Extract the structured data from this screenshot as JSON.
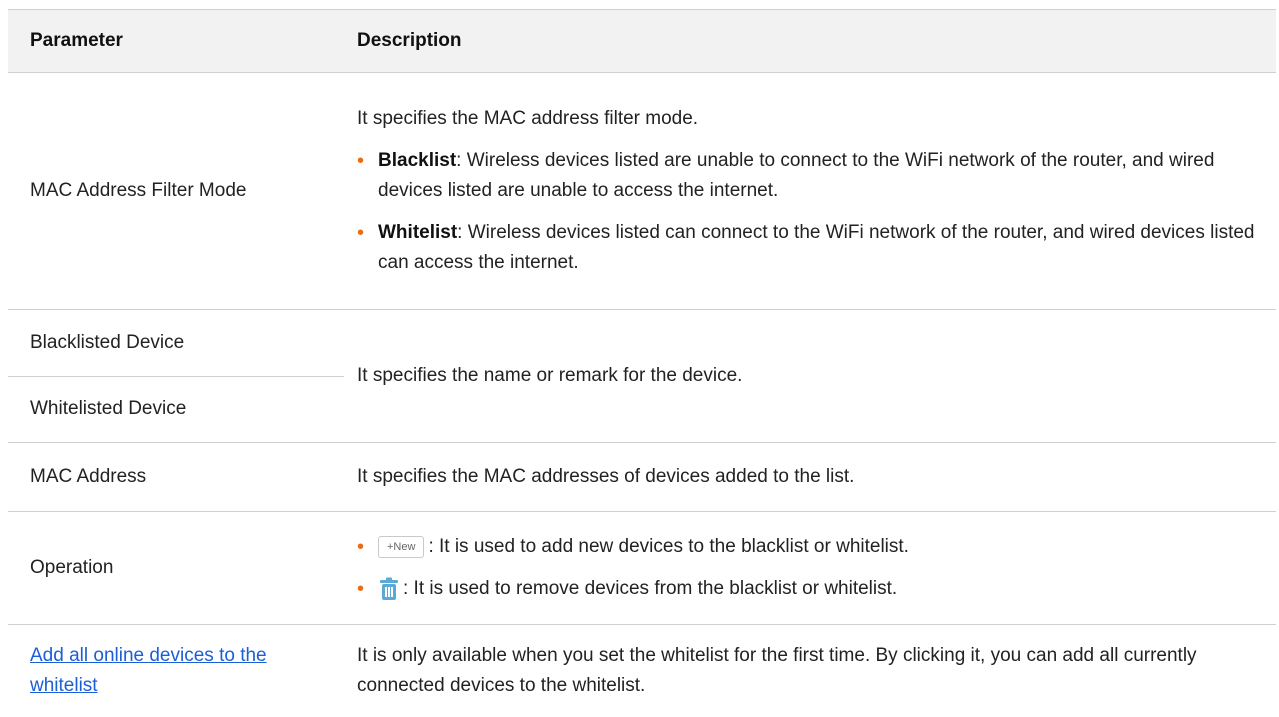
{
  "header": {
    "col_parameter": "Parameter",
    "col_description": "Description"
  },
  "rows": {
    "mode": {
      "name": "MAC Address Filter Mode",
      "intro": "It specifies the MAC address filter mode.",
      "blacklist_term": "Blacklist",
      "blacklist_text": ": Wireless devices listed are unable to connect to the WiFi network of the router, and wired devices listed are unable to access the internet.",
      "whitelist_term": "Whitelist",
      "whitelist_text": ": Wireless devices listed can connect to the WiFi network of the router, and wired devices listed can access the internet."
    },
    "device": {
      "name_blacklisted": "Blacklisted Device",
      "name_whitelisted": "Whitelisted Device",
      "desc": "It specifies the name or remark for the device."
    },
    "mac": {
      "name": "MAC Address",
      "desc": "It specifies the MAC addresses of devices added to the list."
    },
    "operation": {
      "name": "Operation",
      "new_button_label": "+New",
      "new_desc": ": It is used to add new devices to the blacklist or whitelist.",
      "delete_icon": "trash-icon",
      "delete_desc": ": It is used to remove devices from the blacklist or whitelist."
    },
    "add_all": {
      "link_text": "Add all online devices to the whitelist",
      "desc": "It is only available when you set the whitelist for the first time. By clicking it, you can add all currently connected devices to the whitelist."
    }
  },
  "colors": {
    "bullet": "#f06a0f",
    "link": "#1a5fd6",
    "header_bg": "#f2f2f2",
    "icon_blue": "#5aa9d6"
  }
}
